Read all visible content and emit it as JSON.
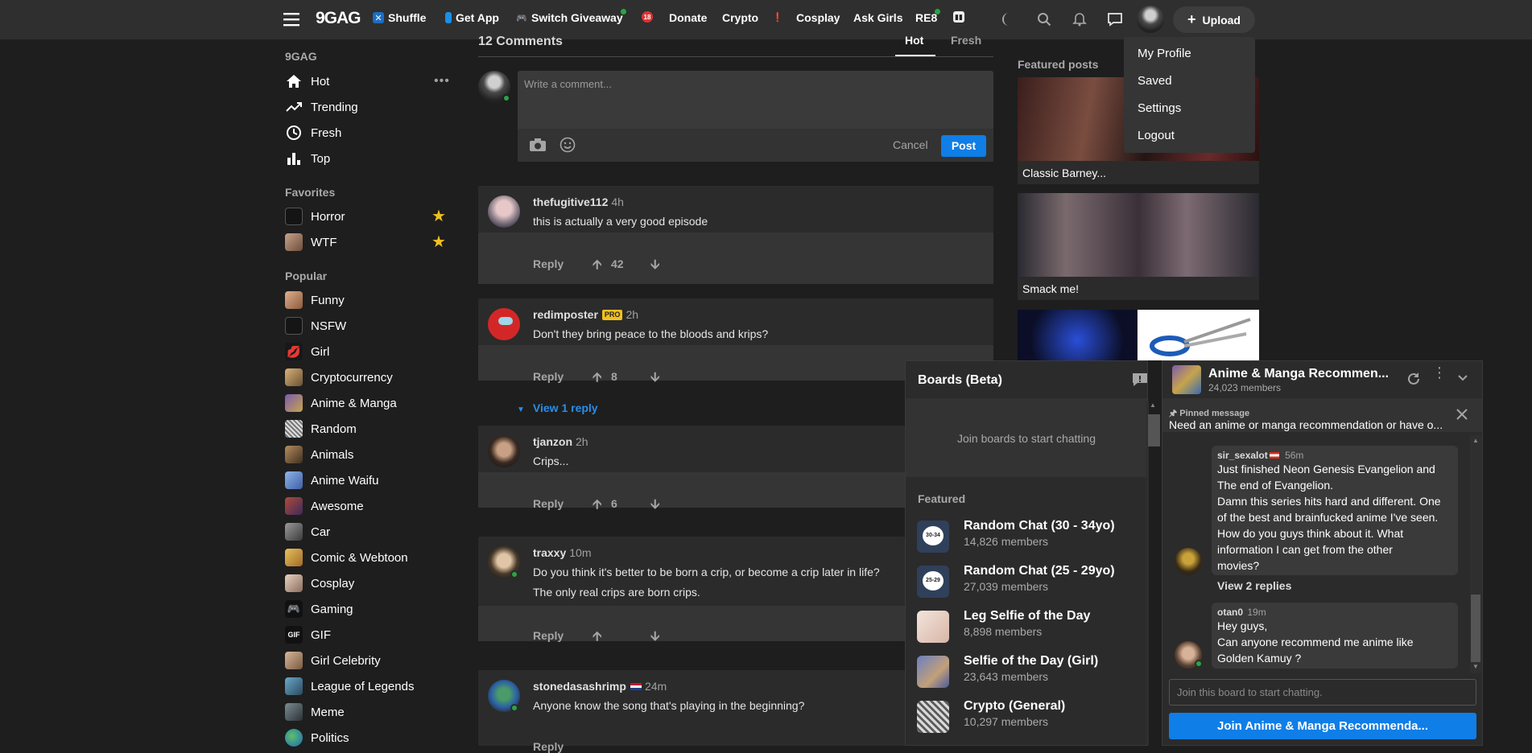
{
  "nav": {
    "logo": "9GAG",
    "items": [
      {
        "label": "Shuffle",
        "icon": "shuffle-icon"
      },
      {
        "label": "Get App",
        "icon": "phone-icon"
      },
      {
        "label": "Switch Giveaway",
        "icon": "gamepad-icon"
      },
      {
        "label": "",
        "icon": "no-sign-icon"
      },
      {
        "label": "Donate",
        "icon": ""
      },
      {
        "label": "Crypto",
        "icon": ""
      },
      {
        "label": "",
        "icon": "pin-icon"
      },
      {
        "label": "Cosplay",
        "icon": ""
      },
      {
        "label": "Ask Girls",
        "icon": ""
      },
      {
        "label": "RE8",
        "icon": ""
      }
    ],
    "upload_label": "Upload"
  },
  "dropdown": {
    "items": [
      "My Profile",
      "Saved",
      "Settings",
      "Logout"
    ]
  },
  "sidebar": {
    "section_title": "9GAG",
    "main": [
      "Hot",
      "Trending",
      "Fresh",
      "Top"
    ],
    "favorites_title": "Favorites",
    "favorites": [
      "Horror",
      "WTF"
    ],
    "popular_title": "Popular",
    "popular": [
      "Funny",
      "NSFW",
      "Girl",
      "Cryptocurrency",
      "Anime & Manga",
      "Random",
      "Animals",
      "Anime Waifu",
      "Awesome",
      "Car",
      "Comic & Webtoon",
      "Cosplay",
      "Gaming",
      "GIF",
      "Girl Celebrity",
      "League of Legends",
      "Meme",
      "Politics"
    ]
  },
  "comments_header": {
    "count": "12 Comments",
    "tab_hot": "Hot",
    "tab_fresh": "Fresh"
  },
  "composer": {
    "placeholder": "Write a comment...",
    "cancel": "Cancel",
    "post": "Post"
  },
  "comments": [
    {
      "user": "thefugitive112",
      "time": "4h",
      "lines": [
        "this is actually a very good episode"
      ],
      "reply": "Reply",
      "votes": "42"
    },
    {
      "user": "redimposter",
      "badge": "PRO",
      "time": "2h",
      "lines": [
        "Don't they bring peace to the bloods and krips?"
      ],
      "reply": "Reply",
      "votes": "8",
      "view_replies": "View 1 reply"
    },
    {
      "user": "tjanzon",
      "time": "2h",
      "lines": [
        "Crips..."
      ],
      "reply": "Reply",
      "votes": "6"
    },
    {
      "user": "traxxy",
      "time": "10m",
      "lines": [
        "Do you think it's better to be born a crip, or become a crip later in life?",
        "The only real crips are born crips."
      ],
      "reply": "Reply",
      "votes": ""
    },
    {
      "user": "stonedasashrimp",
      "time": "24m",
      "lines": [
        "Anyone know the song that's playing in the beginning?"
      ],
      "reply": "Reply",
      "votes": ""
    }
  ],
  "featured": {
    "title": "Featured posts",
    "posts": [
      "Classic Barney...",
      "Smack me!"
    ]
  },
  "boards": {
    "title": "Boards (Beta)",
    "join_text": "Join boards to start chatting",
    "featured_title": "Featured",
    "items": [
      {
        "name": "Random Chat (30 - 34yo)",
        "members": "14,826 members",
        "thumb_label": "30-34"
      },
      {
        "name": "Random Chat (25 - 29yo)",
        "members": "27,039 members",
        "thumb_label": "25-29"
      },
      {
        "name": "Leg Selfie of the Day",
        "members": "8,898 members",
        "thumb_label": ""
      },
      {
        "name": "Selfie of the Day (Girl)",
        "members": "23,643 members",
        "thumb_label": ""
      },
      {
        "name": "Crypto (General)",
        "members": "10,297 members",
        "thumb_label": ""
      }
    ]
  },
  "chat": {
    "title": "Anime & Manga Recommen...",
    "members": "24,023 members",
    "pinned_label": "Pinned message",
    "pinned_text": "Need an anime or manga recommendation or have o...",
    "messages": [
      {
        "user": "sir_sexalot",
        "time": "56m",
        "lines": [
          "Just finished Neon Genesis Evangelion and",
          "The end of Evangelion.",
          "Damn this series hits hard and different. One",
          "of the best and brainfucked anime I've seen.",
          "How do you guys think about it. What",
          "information I can get from the other",
          "movies?"
        ],
        "replies": "View 2 replies"
      },
      {
        "user": "otan0",
        "time": "19m",
        "lines": [
          "Hey guys,",
          "Can anyone recommend me anime like",
          "Golden Kamuy ?"
        ]
      }
    ],
    "input_placeholder": "Join this board to start chatting.",
    "join_button": "Join Anime & Manga Recommenda..."
  },
  "colors": {
    "accent_blue": "#0f7ee6",
    "nav_bg": "#2f2f2f",
    "page_bg": "#1e1e1e",
    "card_bg": "#2b2b2b",
    "star_gold": "#f2c01e",
    "online_green": "#29a642",
    "pro_badge": "#f2c01e"
  }
}
